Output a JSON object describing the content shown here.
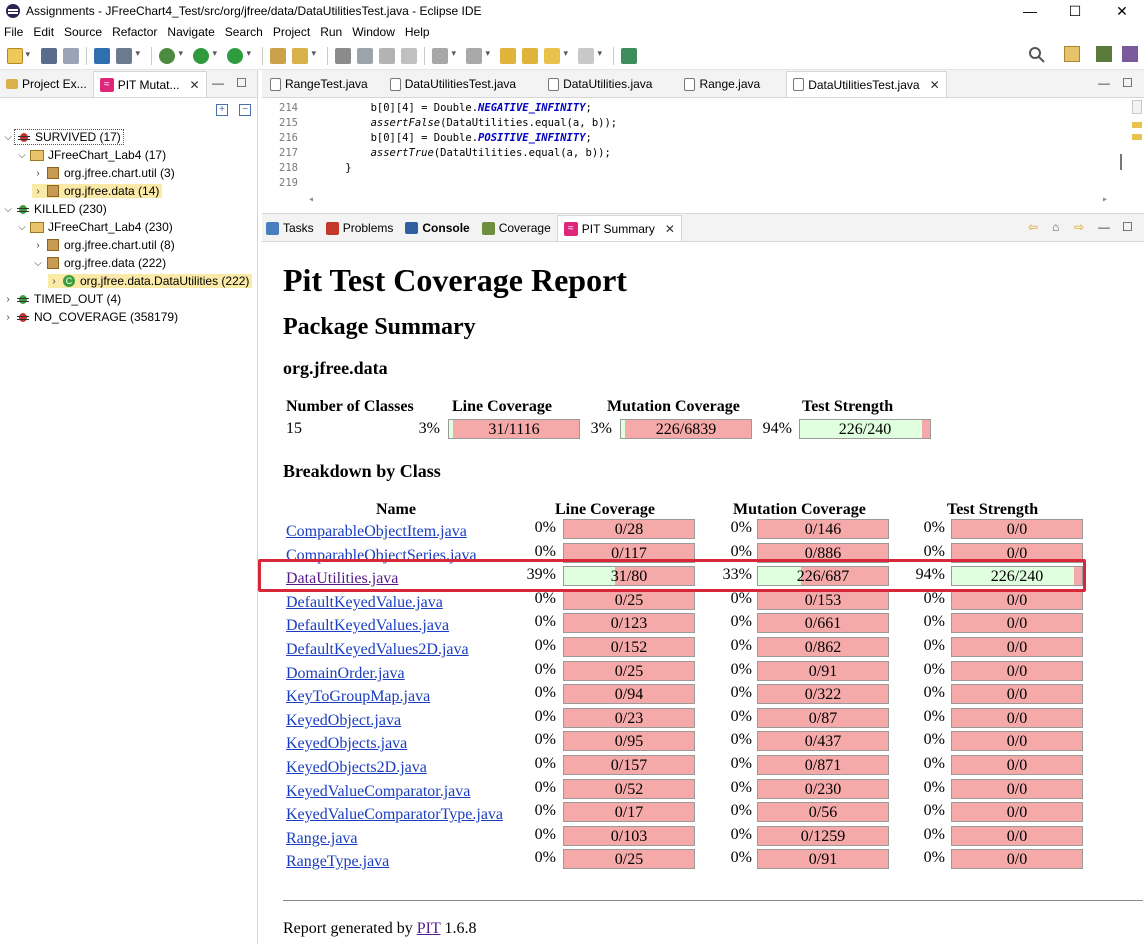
{
  "window": {
    "title": "Assignments - JFreeChart4_Test/src/org/jfree/data/DataUtilitiesTest.java - Eclipse IDE",
    "minimize": "—",
    "maximize": "☐",
    "close": "✕"
  },
  "menu": [
    "File",
    "Edit",
    "Source",
    "Refactor",
    "Navigate",
    "Search",
    "Project",
    "Run",
    "Window",
    "Help"
  ],
  "left_panel": {
    "tabs": [
      {
        "label": "Project Ex...",
        "icon": "project-explorer-icon"
      },
      {
        "label": "PIT Mutat...",
        "icon": "pit-icon",
        "active": true
      }
    ],
    "tree": [
      {
        "label": "SURVIVED (17)",
        "depth": 0,
        "expanded": true,
        "icon": "red-bug-icon",
        "selected_box": true
      },
      {
        "label": "JFreeChart_Lab4 (17)",
        "depth": 1,
        "expanded": true,
        "icon": "project-icon"
      },
      {
        "label": "org.jfree.chart.util (3)",
        "depth": 2,
        "expanded": false,
        "icon": "package-icon"
      },
      {
        "label": "org.jfree.data (14)",
        "depth": 2,
        "expanded": false,
        "icon": "package-icon",
        "highlight": true
      },
      {
        "label": "KILLED (230)",
        "depth": 0,
        "expanded": true,
        "icon": "green-bug-icon"
      },
      {
        "label": "JFreeChart_Lab4 (230)",
        "depth": 1,
        "expanded": true,
        "icon": "project-icon"
      },
      {
        "label": "org.jfree.chart.util (8)",
        "depth": 2,
        "expanded": false,
        "icon": "package-icon"
      },
      {
        "label": "org.jfree.data (222)",
        "depth": 2,
        "expanded": true,
        "icon": "package-icon"
      },
      {
        "label": "org.jfree.data.DataUtilities (222)",
        "depth": 3,
        "expanded": false,
        "icon": "class-icon",
        "highlight": true
      },
      {
        "label": "TIMED_OUT (4)",
        "depth": 0,
        "expanded": false,
        "icon": "green-bug-icon"
      },
      {
        "label": "NO_COVERAGE (358179)",
        "depth": 0,
        "expanded": false,
        "icon": "red-bug-icon"
      }
    ]
  },
  "editor": {
    "tabs": [
      {
        "label": "RangeTest.java"
      },
      {
        "label": "DataUtilitiesTest.java"
      },
      {
        "label": "DataUtilities.java"
      },
      {
        "label": "Range.java"
      },
      {
        "label": "DataUtilitiesTest.java",
        "active": true
      }
    ],
    "lines": [
      {
        "num": "214",
        "pre": "        b[0][4] = Double.",
        "field": "NEGATIVE_INFINITY",
        "post": ";"
      },
      {
        "num": "215",
        "pre": "        ",
        "italic": "assertFalse",
        "post": "(DataUtilities.equal(a, b));"
      },
      {
        "num": "216",
        "pre": "        b[0][4] = Double.",
        "field": "POSITIVE_INFINITY",
        "post": ";"
      },
      {
        "num": "217",
        "pre": "        ",
        "italic": "assertTrue",
        "post": "(DataUtilities.equal(a, b));"
      },
      {
        "num": "218",
        "pre": "    }",
        "post": ""
      },
      {
        "num": "219",
        "pre": "",
        "post": ""
      }
    ]
  },
  "bottom_panel": {
    "tabs": [
      {
        "label": "Tasks"
      },
      {
        "label": "Problems"
      },
      {
        "label": "Console"
      },
      {
        "label": "Coverage"
      },
      {
        "label": "PIT Summary",
        "active": true
      }
    ]
  },
  "report": {
    "title": "Pit Test Coverage Report",
    "package_summary": "Package Summary",
    "package_name": "org.jfree.data",
    "summary_headers": {
      "classes": "Number of Classes",
      "line": "Line Coverage",
      "mutation": "Mutation Coverage",
      "strength": "Test Strength"
    },
    "summary": {
      "classes": "15",
      "line_pct": "3%",
      "line_txt": "31/1116",
      "line_frac": 0.03,
      "mut_pct": "3%",
      "mut_txt": "226/6839",
      "mut_frac": 0.03,
      "str_pct": "94%",
      "str_txt": "226/240",
      "str_frac": 0.94
    },
    "breakdown_title": "Breakdown by Class",
    "breakdown_headers": {
      "name": "Name",
      "line": "Line Coverage",
      "mutation": "Mutation Coverage",
      "strength": "Test Strength"
    },
    "classes": [
      {
        "name": "ComparableObjectItem.java",
        "line_pct": "0%",
        "line_txt": "0/28",
        "line_frac": 0,
        "mut_pct": "0%",
        "mut_txt": "0/146",
        "mut_frac": 0,
        "str_pct": "0%",
        "str_txt": "0/0",
        "str_frac": 0
      },
      {
        "name": "ComparableObjectSeries.java",
        "line_pct": "0%",
        "line_txt": "0/117",
        "line_frac": 0,
        "mut_pct": "0%",
        "mut_txt": "0/886",
        "mut_frac": 0,
        "str_pct": "0%",
        "str_txt": "0/0",
        "str_frac": 0
      },
      {
        "name": "DataUtilities.java",
        "visited": true,
        "line_pct": "39%",
        "line_txt": "31/80",
        "line_frac": 0.39,
        "mut_pct": "33%",
        "mut_txt": "226/687",
        "mut_frac": 0.33,
        "str_pct": "94%",
        "str_txt": "226/240",
        "str_frac": 0.94
      },
      {
        "name": "DefaultKeyedValue.java",
        "line_pct": "0%",
        "line_txt": "0/25",
        "line_frac": 0,
        "mut_pct": "0%",
        "mut_txt": "0/153",
        "mut_frac": 0,
        "str_pct": "0%",
        "str_txt": "0/0",
        "str_frac": 0
      },
      {
        "name": "DefaultKeyedValues.java",
        "line_pct": "0%",
        "line_txt": "0/123",
        "line_frac": 0,
        "mut_pct": "0%",
        "mut_txt": "0/661",
        "mut_frac": 0,
        "str_pct": "0%",
        "str_txt": "0/0",
        "str_frac": 0
      },
      {
        "name": "DefaultKeyedValues2D.java",
        "line_pct": "0%",
        "line_txt": "0/152",
        "line_frac": 0,
        "mut_pct": "0%",
        "mut_txt": "0/862",
        "mut_frac": 0,
        "str_pct": "0%",
        "str_txt": "0/0",
        "str_frac": 0
      },
      {
        "name": "DomainOrder.java",
        "line_pct": "0%",
        "line_txt": "0/25",
        "line_frac": 0,
        "mut_pct": "0%",
        "mut_txt": "0/91",
        "mut_frac": 0,
        "str_pct": "0%",
        "str_txt": "0/0",
        "str_frac": 0
      },
      {
        "name": "KeyToGroupMap.java",
        "line_pct": "0%",
        "line_txt": "0/94",
        "line_frac": 0,
        "mut_pct": "0%",
        "mut_txt": "0/322",
        "mut_frac": 0,
        "str_pct": "0%",
        "str_txt": "0/0",
        "str_frac": 0
      },
      {
        "name": "KeyedObject.java",
        "line_pct": "0%",
        "line_txt": "0/23",
        "line_frac": 0,
        "mut_pct": "0%",
        "mut_txt": "0/87",
        "mut_frac": 0,
        "str_pct": "0%",
        "str_txt": "0/0",
        "str_frac": 0
      },
      {
        "name": "KeyedObjects.java",
        "line_pct": "0%",
        "line_txt": "0/95",
        "line_frac": 0,
        "mut_pct": "0%",
        "mut_txt": "0/437",
        "mut_frac": 0,
        "str_pct": "0%",
        "str_txt": "0/0",
        "str_frac": 0
      },
      {
        "name": "KeyedObjects2D.java",
        "line_pct": "0%",
        "line_txt": "0/157",
        "line_frac": 0,
        "mut_pct": "0%",
        "mut_txt": "0/871",
        "mut_frac": 0,
        "str_pct": "0%",
        "str_txt": "0/0",
        "str_frac": 0
      },
      {
        "name": "KeyedValueComparator.java",
        "line_pct": "0%",
        "line_txt": "0/52",
        "line_frac": 0,
        "mut_pct": "0%",
        "mut_txt": "0/230",
        "mut_frac": 0,
        "str_pct": "0%",
        "str_txt": "0/0",
        "str_frac": 0
      },
      {
        "name": "KeyedValueComparatorType.java",
        "line_pct": "0%",
        "line_txt": "0/17",
        "line_frac": 0,
        "mut_pct": "0%",
        "mut_txt": "0/56",
        "mut_frac": 0,
        "str_pct": "0%",
        "str_txt": "0/0",
        "str_frac": 0
      },
      {
        "name": "Range.java",
        "line_pct": "0%",
        "line_txt": "0/103",
        "line_frac": 0,
        "mut_pct": "0%",
        "mut_txt": "0/1259",
        "mut_frac": 0,
        "str_pct": "0%",
        "str_txt": "0/0",
        "str_frac": 0
      },
      {
        "name": "RangeType.java",
        "line_pct": "0%",
        "line_txt": "0/25",
        "line_frac": 0,
        "mut_pct": "0%",
        "mut_txt": "0/91",
        "mut_frac": 0,
        "str_pct": "0%",
        "str_txt": "0/0",
        "str_frac": 0
      }
    ],
    "footer_prefix": "Report generated by ",
    "footer_link": "PIT",
    "footer_version": " 1.6.8"
  },
  "colors": {
    "bar_covered": "#dfffdf",
    "bar_uncovered": "#f5a9a9",
    "highlight_box": "#d9273a",
    "tree_highlight": "#fbeaa7"
  }
}
